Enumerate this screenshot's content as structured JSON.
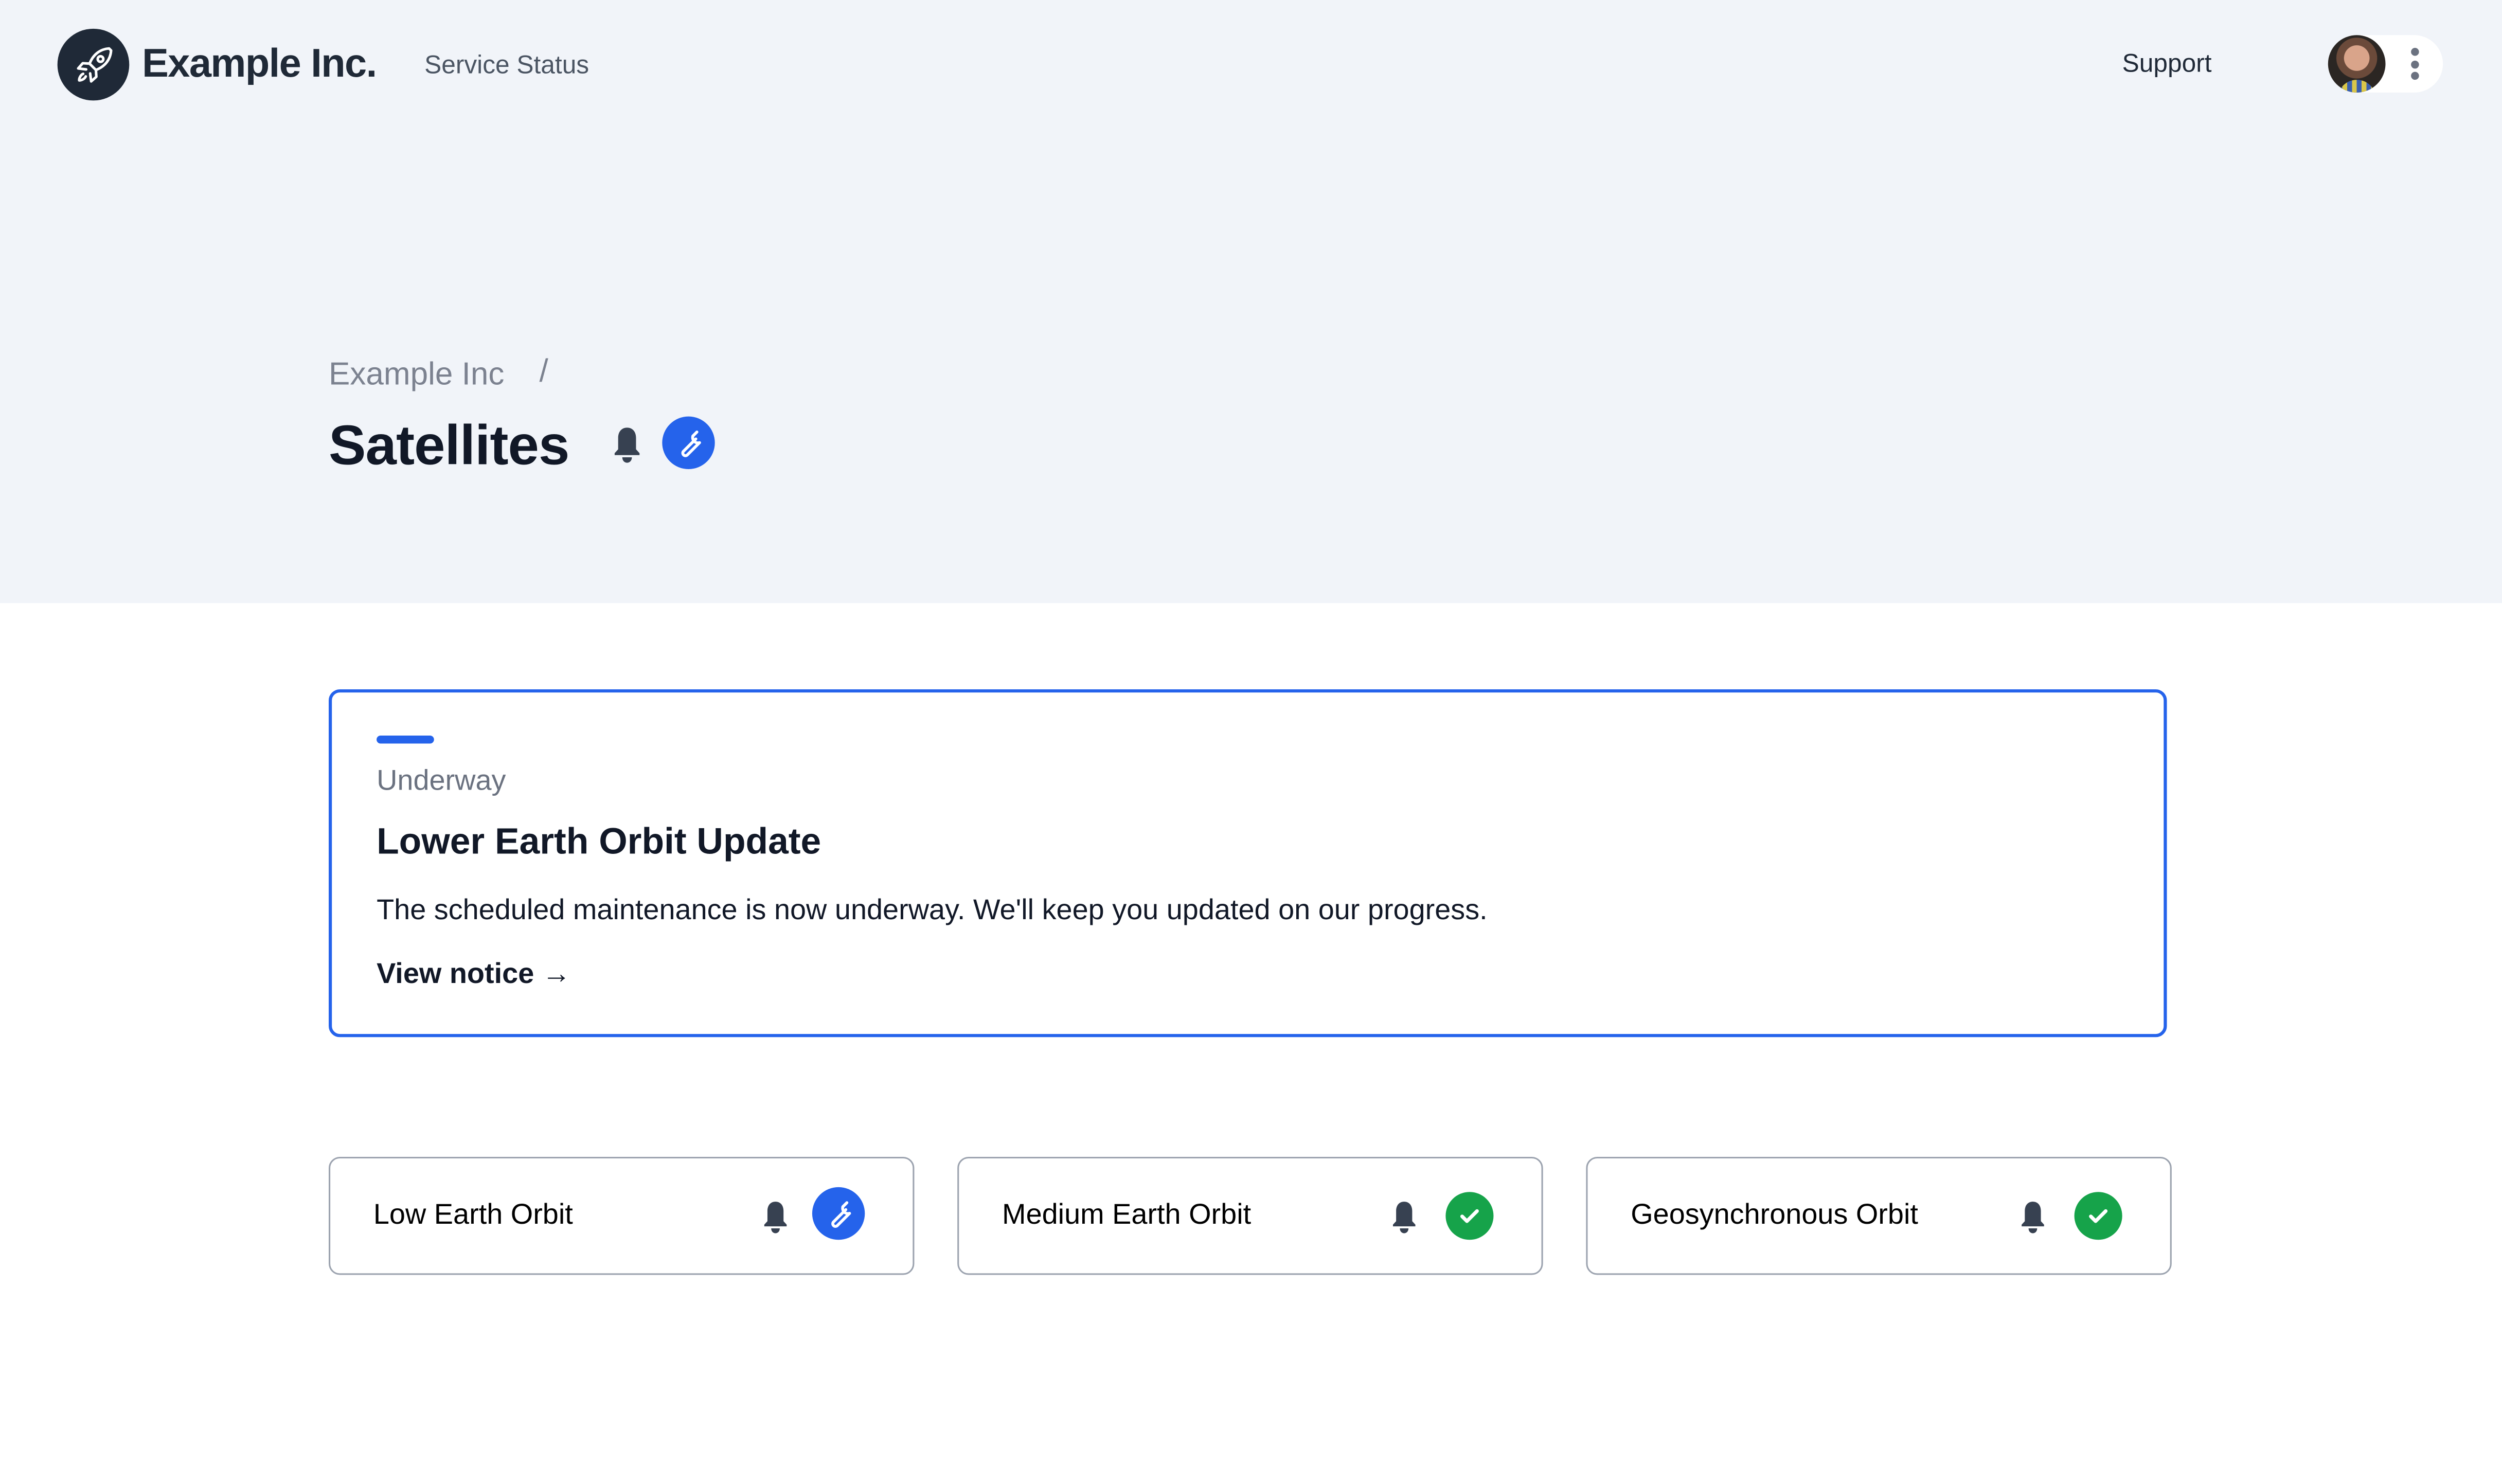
{
  "header": {
    "brand": "Example Inc.",
    "nav_service_status": "Service Status",
    "nav_support": "Support",
    "logo_icon": "rocket-icon",
    "user_menu_icon": "kebab-menu-icon"
  },
  "breadcrumb": {
    "parent": "Example Inc",
    "separator": "/"
  },
  "page": {
    "title": "Satellites",
    "subscribe_icon": "bell-icon",
    "status_icon": "wrench-icon",
    "status": "maintenance"
  },
  "notice": {
    "status": "Underway",
    "title": "Lower Earth Orbit Update",
    "body": "The scheduled maintenance is now underway. We'll keep you updated on our progress.",
    "link_label": "View notice →",
    "accent_color": "#2563eb"
  },
  "components": [
    {
      "name": "Low Earth Orbit",
      "status": "maintenance",
      "status_icon": "wrench-icon",
      "color": "#2563eb"
    },
    {
      "name": "Medium Earth Orbit",
      "status": "operational",
      "status_icon": "check-icon",
      "color": "#16a34a"
    },
    {
      "name": "Geosynchronous Orbit",
      "status": "operational",
      "status_icon": "check-icon",
      "color": "#16a34a"
    }
  ],
  "colors": {
    "maintenance": "#2563eb",
    "operational": "#16a34a",
    "hero_bg": "#f1f4f9",
    "text": "#111827"
  }
}
